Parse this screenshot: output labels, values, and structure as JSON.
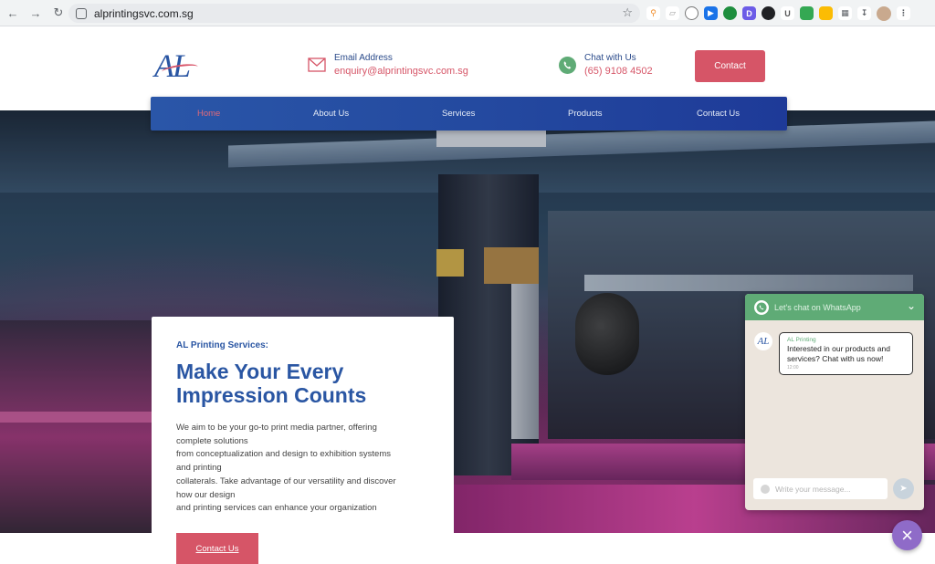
{
  "browser": {
    "url": "alprintingsvc.com.sg"
  },
  "header": {
    "logo_text": "AL",
    "email_label": "Email Address",
    "email_value": "enquiry@alprintingsvc.com.sg",
    "chat_label": "Chat with Us",
    "chat_value": "(65) 9108 4502",
    "contact_button": "Contact"
  },
  "nav": {
    "items": [
      {
        "label": "Home",
        "active": true
      },
      {
        "label": "About Us"
      },
      {
        "label": "Services"
      },
      {
        "label": "Products"
      },
      {
        "label": "Contact Us"
      }
    ]
  },
  "hero": {
    "subtitle": "AL Printing Services:",
    "title": "Make Your Every Impression Counts",
    "body_lines": [
      "We aim to be your go-to print media partner, offering",
      "complete solutions",
      "from conceptualization and design to exhibition systems",
      "and printing",
      "collaterals. Take advantage of our versatility and discover",
      "how our design",
      "and printing services can enhance your organization"
    ],
    "button": "Contact Us"
  },
  "whatsapp": {
    "header": "Let's chat on WhatsApp",
    "avatar_text": "AL",
    "sender": "AL Printing",
    "message": "Interested in our products and services? Chat with us now!",
    "time": "12:00",
    "input_placeholder": "Write your message..."
  },
  "colors": {
    "brand_blue": "#2a56a3",
    "accent_pink": "#d65567",
    "whatsapp_green": "#5fab76",
    "close_purple": "#8f6bc8"
  }
}
